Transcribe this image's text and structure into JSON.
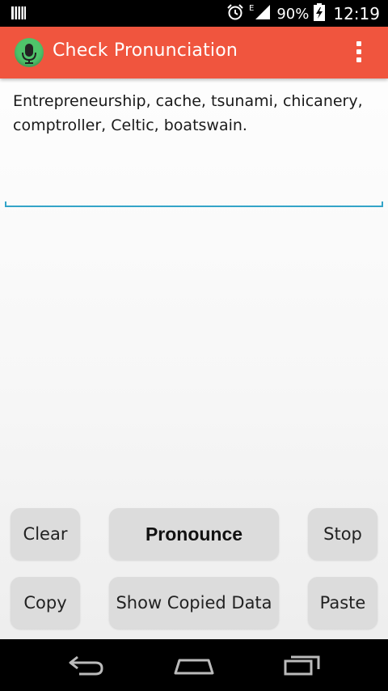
{
  "status_bar": {
    "network_label": "E",
    "battery_percent": "90%",
    "time": "12:19",
    "icons": [
      "notification-icon",
      "alarm-icon",
      "signal-icon",
      "battery-charging-icon"
    ]
  },
  "app_bar": {
    "title": "Check Pronunciation",
    "app_icon": "microphone-icon",
    "menu_icon": "overflow-menu-icon",
    "color": "#f0553e"
  },
  "input": {
    "value": "Entrepreneurship, cache, tsunami, chicanery, comptroller, Celtic, boatswain.",
    "underline_color": "#33a4c8"
  },
  "buttons": {
    "clear": "Clear",
    "pronounce": "Pronounce",
    "stop": "Stop",
    "copy": "Copy",
    "show_copied_data": "Show Copied Data",
    "paste": "Paste"
  },
  "nav_bar": {
    "icons": [
      "back-icon",
      "home-icon",
      "recent-apps-icon"
    ]
  }
}
